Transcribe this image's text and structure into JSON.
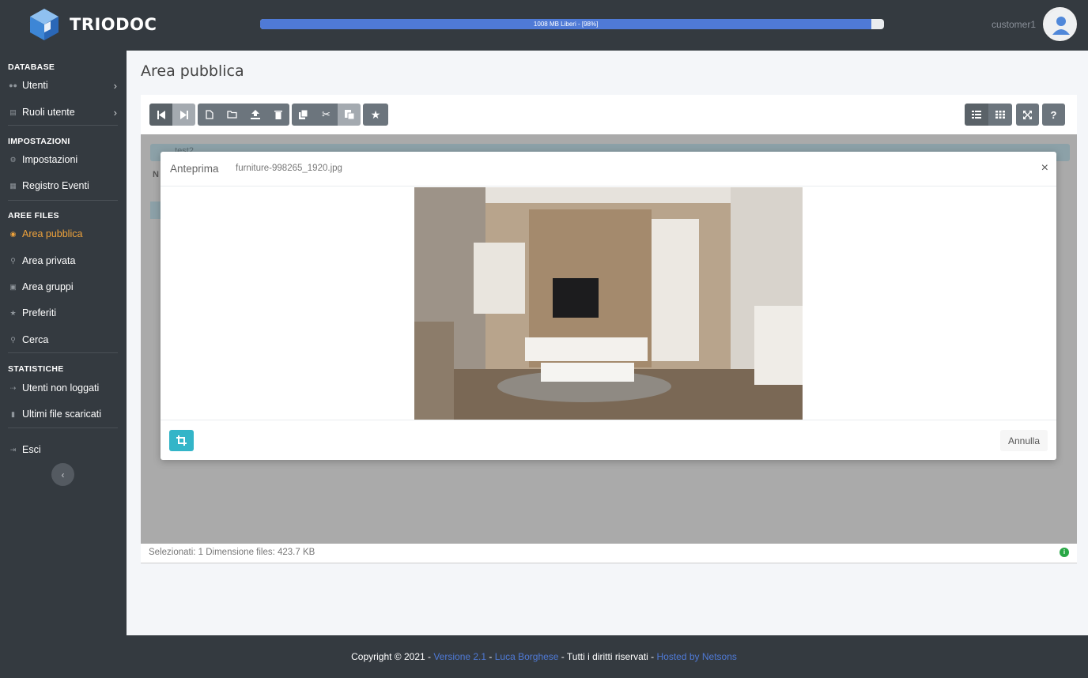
{
  "header": {
    "app_name": "TRIODOC",
    "quota_label": "1008 MB Liberi - [98%]",
    "quota_percent": 98,
    "username": "customer1"
  },
  "sidebar": {
    "sections": [
      {
        "title": "DATABASE",
        "items": [
          {
            "label": "Utenti",
            "icon": "users-icon",
            "chevron": true
          },
          {
            "label": "Ruoli utente",
            "icon": "id-card-icon",
            "chevron": true
          }
        ]
      },
      {
        "title": "IMPOSTAZIONI",
        "items": [
          {
            "label": "Impostazioni",
            "icon": "gear-icon"
          },
          {
            "label": "Registro Eventi",
            "icon": "calendar-icon"
          }
        ]
      },
      {
        "title": "AREE FILES",
        "items": [
          {
            "label": "Area pubblica",
            "icon": "globe-icon",
            "active": true
          },
          {
            "label": "Area privata",
            "icon": "key-icon"
          },
          {
            "label": "Area gruppi",
            "icon": "puzzle-icon"
          },
          {
            "label": "Preferiti",
            "icon": "star-icon"
          },
          {
            "label": "Cerca",
            "icon": "search-icon"
          }
        ]
      },
      {
        "title": "STATISTICHE",
        "items": [
          {
            "label": "Utenti non loggati",
            "icon": "sign-in-icon"
          },
          {
            "label": "Ultimi file scaricati",
            "icon": "file-icon"
          }
        ]
      }
    ],
    "logout_label": "Esci"
  },
  "main": {
    "title": "Area pubblica",
    "background_fragments": [
      "_test2",
      "N"
    ],
    "status_text": "Selezionati: 1 Dimensione files: 423.7 KB"
  },
  "modal": {
    "title": "Anteprima",
    "filename": "furniture-998265_1920.jpg",
    "close": "×",
    "cancel_label": "Annulla"
  },
  "footer": {
    "copyright": "Copyright © 2021 - ",
    "version": "Versione 2.1",
    "sep1": " - ",
    "author": "Luca Borghese",
    "rights": " - Tutti i diritti riservati - ",
    "hosted": "Hosted by Netsons"
  },
  "colors": {
    "sidebar_bg": "#343a40",
    "active": "#f0a33b",
    "accent": "#4f7ad6",
    "crop_btn": "#33b5c8"
  }
}
